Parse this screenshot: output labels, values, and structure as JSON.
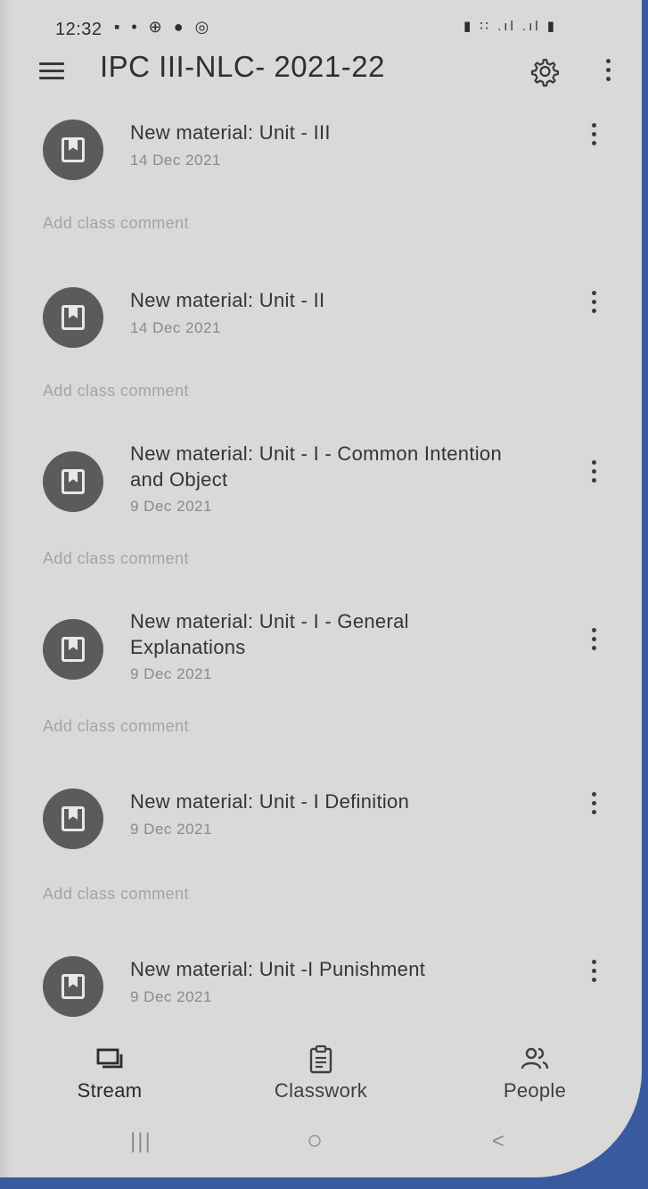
{
  "status_bar": {
    "time": "12:32",
    "left_icons": "▪ • ⊕ ● ◎",
    "right_icons": "▮ ∷ .ıl .ıl ▮"
  },
  "app_bar": {
    "title": "IPC III-NLC- 2021-22",
    "menu_icon": "hamburger-icon",
    "settings_icon": "gear-icon",
    "overflow_icon": "more-vert-icon"
  },
  "stream": {
    "posts": [
      {
        "title": "New material: Unit - III",
        "date": "14 Dec 2021",
        "comment_placeholder": "Add class comment"
      },
      {
        "title": "New material: Unit - II",
        "date": "14 Dec 2021",
        "comment_placeholder": "Add class comment"
      },
      {
        "title": "New material: Unit - I - Common Intention and Object",
        "date": "9 Dec 2021",
        "comment_placeholder": "Add class comment"
      },
      {
        "title": "New material: Unit - I - General Explanations",
        "date": "9 Dec 2021",
        "comment_placeholder": "Add class comment"
      },
      {
        "title": "New material: Unit - I Definition",
        "date": "9 Dec 2021",
        "comment_placeholder": "Add class comment"
      },
      {
        "title": "New material: Unit -I Punishment",
        "date": "9 Dec 2021"
      }
    ]
  },
  "bottom_nav": {
    "items": [
      {
        "label": "Stream",
        "icon": "stream-icon",
        "active": true
      },
      {
        "label": "Classwork",
        "icon": "classwork-icon",
        "active": false
      },
      {
        "label": "People",
        "icon": "people-icon",
        "active": false
      }
    ]
  },
  "system_nav": {
    "recents": "|||",
    "home": "○",
    "back": "<"
  },
  "colors": {
    "background": "#d9d9d7",
    "text_primary": "#353535",
    "text_muted": "#8a8a8a",
    "avatar": "#5b5b5b"
  }
}
